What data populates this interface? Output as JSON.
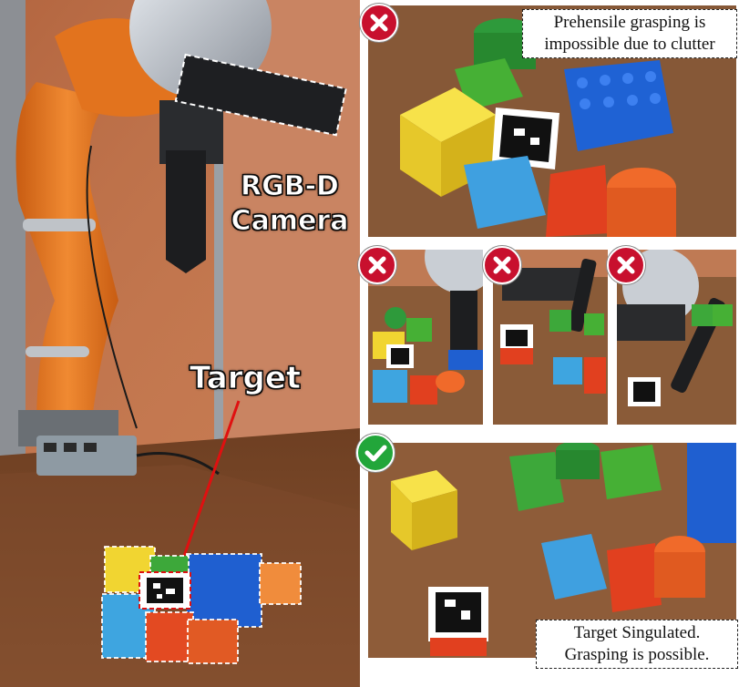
{
  "main_scene": {
    "camera_label_line1": "RGB-D",
    "camera_label_line2": "Camera",
    "target_label": "Target"
  },
  "top_panel": {
    "status": "fail",
    "status_icon": "cross-icon",
    "caption_line1": "Prehensile grasping is",
    "caption_line2": "impossible due to clutter"
  },
  "middle_panels": [
    {
      "status": "fail",
      "status_icon": "cross-icon"
    },
    {
      "status": "fail",
      "status_icon": "cross-icon"
    },
    {
      "status": "fail",
      "status_icon": "cross-icon"
    }
  ],
  "bottom_panel": {
    "status": "success",
    "status_icon": "check-icon",
    "caption_line1": "Target Singulated.",
    "caption_line2": "Grasping is possible."
  },
  "colors": {
    "fail": "#c8102e",
    "success": "#22a63a",
    "robot_orange": "#e9751f",
    "table_wood": "#7a4a2a",
    "wall": "#b8663f"
  }
}
